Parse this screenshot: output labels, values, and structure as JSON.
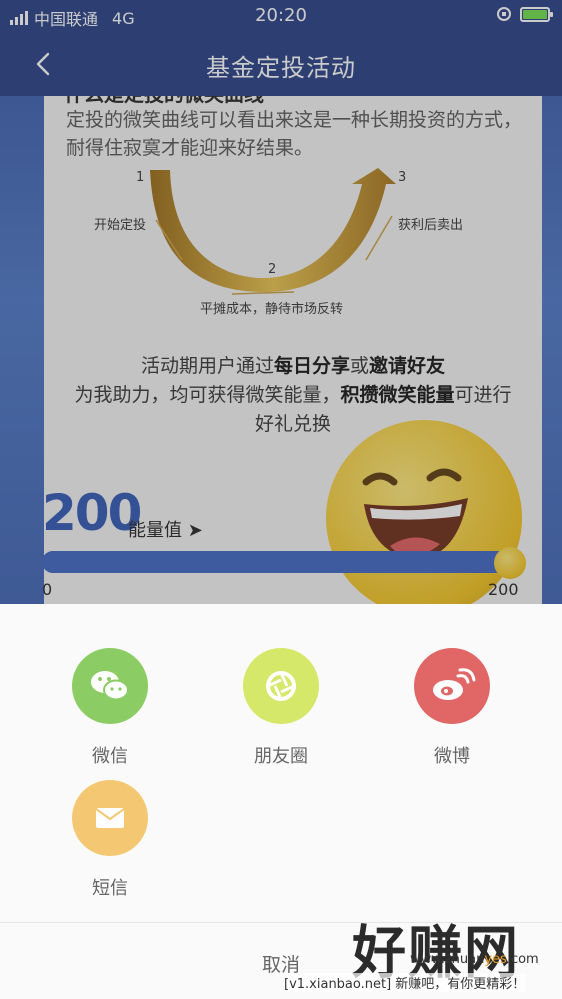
{
  "status_bar": {
    "carrier": "中国联通",
    "network": "4G",
    "time": "20:20"
  },
  "nav": {
    "title": "基金定投活动"
  },
  "content": {
    "heading": "什么是定投的微笑曲线",
    "description": "定投的微笑曲线可以看出来这是一种长期投资的方式，耐得住寂寞才能迎来好结果。",
    "curve": {
      "step1_num": "1",
      "step1_label": "开始定投",
      "step2_num": "2",
      "step2_label": "平摊成本，静待市场反转",
      "step3_num": "3",
      "step3_label": "获利后卖出"
    },
    "activity": {
      "line1_pre": "活动期用户通过",
      "line1_bold1": "每日分享",
      "line1_mid": "或",
      "line1_bold2": "邀请好友",
      "line2_pre": "为我助力，均可获得微笑能量，",
      "line2_bold": "积攒微笑能量",
      "line2_post": "可进行",
      "line3": "好礼兑换"
    },
    "energy": {
      "value": "200",
      "label": "能量值",
      "min_label": "0",
      "max_label": "200",
      "progress_fraction": 1.0
    }
  },
  "share_sheet": {
    "items": [
      {
        "label": "微信",
        "icon": "wechat-icon",
        "color": "#8ccc64"
      },
      {
        "label": "朋友圈",
        "icon": "moments-icon",
        "color": "#d6e86a"
      },
      {
        "label": "微博",
        "icon": "weibo-icon",
        "color": "#e16666"
      },
      {
        "label": "短信",
        "icon": "sms-icon",
        "color": "#f4c872"
      }
    ],
    "cancel": "取消"
  },
  "watermark": {
    "logo": "好赚网",
    "url_pre": "www.zhuan",
    "url_highlight": "yes",
    "url_post": ".com",
    "line": "[v1.xianbao.net] 新赚吧，有你更精彩！"
  }
}
